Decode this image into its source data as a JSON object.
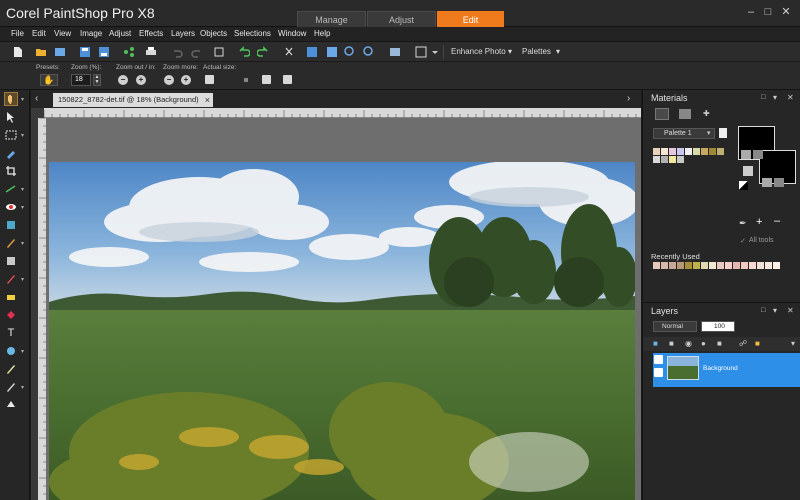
{
  "app": {
    "title": "Corel PaintShop Pro X8",
    "workspace_tabs": [
      {
        "label": "Manage",
        "active": false
      },
      {
        "label": "Adjust",
        "active": false
      },
      {
        "label": "Edit",
        "active": true
      }
    ],
    "accent_color": "#f07b1c"
  },
  "menu": {
    "items": [
      "File",
      "Edit",
      "View",
      "Image",
      "Adjust",
      "Effects",
      "Layers",
      "Objects",
      "Selections",
      "Window",
      "Help"
    ]
  },
  "toolbar": {
    "enhance_photo_label": "Enhance Photo",
    "palettes_label": "Palettes"
  },
  "options": {
    "presets_label": "Presets:",
    "zoom_label": "Zoom (%):",
    "zoom_value": "18",
    "zoom_out_in_label": "Zoom out / in:",
    "zoom_more_label": "Zoom more:",
    "actual_size_label": "Actual size:"
  },
  "document": {
    "tab_title": "150822_8782-det.tif @  18% (Background)",
    "close_glyph": "×"
  },
  "materials": {
    "title": "Materials",
    "palette_dropdown": "Palette 1",
    "all_tools_label": "All tools",
    "recently_used_label": "Recently Used",
    "palette_swatches": [
      "#e8d2b8",
      "#f4e6d0",
      "#e4c8e0",
      "#c8c8f0",
      "#f0f0f0",
      "#d8d8a8",
      "#c8a860",
      "#9c8a30",
      "#c0b070",
      "#d8d8d8",
      "#b0b0b0",
      "#f0e8a0",
      "#c8c8c8"
    ],
    "recent_swatches": [
      "#e8c8b8",
      "#d8b8a8",
      "#c8a898",
      "#b89878",
      "#a89038",
      "#c0b048",
      "#e0d8b0",
      "#f0e8d0",
      "#e8c8c0",
      "#f4d0c8",
      "#e8b8b0",
      "#f0c8c0",
      "#f8d8d0",
      "#f0e0d8",
      "#f8e8e0",
      "#fff0e8"
    ]
  },
  "layers": {
    "title": "Layers",
    "blend_mode": "Normal",
    "opacity": "100",
    "layer_name": "Background",
    "selected_color": "#2e8fe8"
  }
}
